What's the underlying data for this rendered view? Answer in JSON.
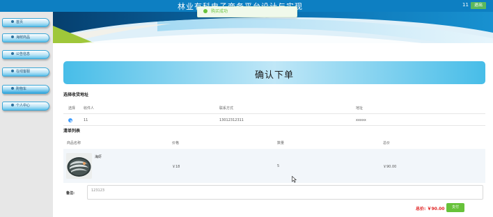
{
  "header": {
    "site_title": "林业有科电子商务平台设计与实现",
    "user": "11",
    "logout_label": "退出"
  },
  "toast": {
    "message": "购买成功"
  },
  "sidebar": {
    "items": [
      {
        "label": "首页",
        "icon": "home-icon"
      },
      {
        "label": "海鲜商品",
        "icon": "fish-icon"
      },
      {
        "label": "公告信息",
        "icon": "info-icon"
      },
      {
        "label": "在线客服",
        "icon": "chat-icon"
      },
      {
        "label": "购物车",
        "icon": "cart-icon"
      },
      {
        "label": "个人中心",
        "icon": "user-icon"
      }
    ]
  },
  "page": {
    "title": "确认下单"
  },
  "address": {
    "section_label": "选择收货地址",
    "columns": [
      "选择",
      "收件人",
      "联系方式",
      "地址"
    ],
    "rows": [
      {
        "selected": true,
        "recipient": "11",
        "phone": "13012312311",
        "address": "xxxxx"
      }
    ]
  },
  "order": {
    "section_label": "清单列表",
    "columns": [
      "商品名称",
      "价格",
      "数量",
      "总价"
    ],
    "items": [
      {
        "name": "海虾",
        "price": "￥18",
        "quantity": "5",
        "total": "￥90.00"
      }
    ]
  },
  "remark": {
    "label": "备注:",
    "value": "123123"
  },
  "summary": {
    "total_label": "总价: ￥90.00",
    "pay_label": "支付"
  },
  "colors": {
    "accent": "#0d7fc2",
    "success": "#67c23a",
    "price": "#e02020"
  }
}
